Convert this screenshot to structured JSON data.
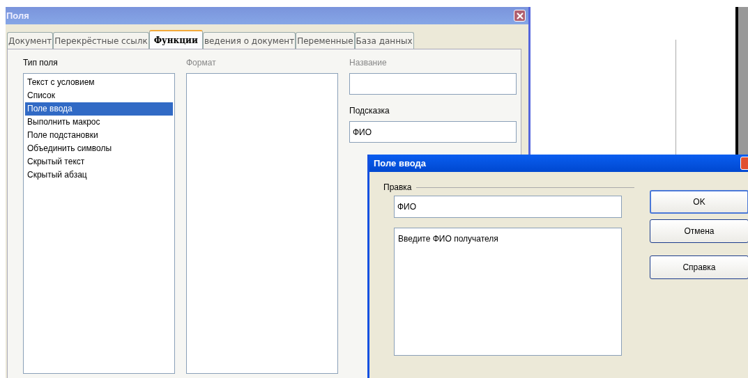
{
  "window": {
    "title": "Поля"
  },
  "tabs": [
    {
      "label": "Документ",
      "selected": false
    },
    {
      "label": "Перекрёстные ссылк",
      "selected": false
    },
    {
      "label": "Функции",
      "selected": true
    },
    {
      "label": "ведения о документ",
      "selected": false
    },
    {
      "label": "Переменные",
      "selected": false
    },
    {
      "label": "База данных",
      "selected": false
    }
  ],
  "field_type": {
    "label": "Тип поля",
    "disabled": false,
    "items": [
      {
        "label": "Текст с условием",
        "selected": false
      },
      {
        "label": "Список",
        "selected": false
      },
      {
        "label": "Поле ввода",
        "selected": true
      },
      {
        "label": "Выполнить макрос",
        "selected": false
      },
      {
        "label": "Поле подстановки",
        "selected": false
      },
      {
        "label": "Объединить символы",
        "selected": false
      },
      {
        "label": "Скрытый текст",
        "selected": false
      },
      {
        "label": "Скрытый абзац",
        "selected": false
      }
    ]
  },
  "format": {
    "label": "Формат",
    "disabled": true
  },
  "name": {
    "label": "Название",
    "disabled": true
  },
  "hint": {
    "label": "Подсказка",
    "disabled": false,
    "value": "ФИО"
  },
  "input_dialog": {
    "title": "Поле ввода",
    "group": "Правка",
    "field": "ФИО",
    "text": "Введите ФИО получателя",
    "buttons": [
      {
        "label": "OK",
        "default": true
      },
      {
        "label": "Отмена",
        "default": false
      },
      {
        "label": "Справка",
        "default": false
      }
    ]
  }
}
